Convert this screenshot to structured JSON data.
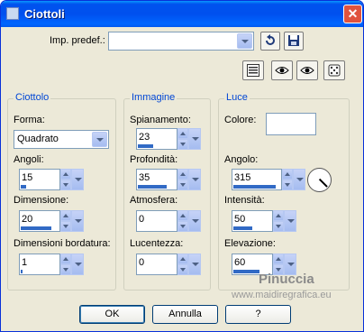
{
  "window": {
    "title": "Ciottoli",
    "close_glyph": "✕"
  },
  "toolbar": {
    "preset_label": "Imp. predef.:",
    "preset_value": "",
    "icons": {
      "reset": "reset-arrow-icon",
      "save": "save-disk-icon",
      "list": "list-view-icon",
      "eye_toggle_1": "eye-toggle-icon",
      "eye_toggle_2": "eye-icon",
      "randomize": "dice-icon"
    }
  },
  "ciottolo": {
    "title": "Ciottolo",
    "forma_label": "Forma:",
    "forma_value": "Quadrato",
    "angoli_label": "Angoli:",
    "angoli_value": "15",
    "dimensione_label": "Dimensione:",
    "dimensione_value": "20",
    "bordatura_label": "Dimensioni bordatura:",
    "bordatura_value": "1"
  },
  "immagine": {
    "title": "Immagine",
    "spianamento_label": "Spianamento:",
    "spianamento_value": "23",
    "profondita_label": "Profondità:",
    "profondita_value": "35",
    "atmosfera_label": "Atmosfera:",
    "atmosfera_value": "0",
    "lucentezza_label": "Lucentezza:",
    "lucentezza_value": "0"
  },
  "luce": {
    "title": "Luce",
    "colore_label": "Colore:",
    "colore_value": "#FFFFFF",
    "angolo_label": "Angolo:",
    "angolo_value": "315",
    "intensita_label": "Intensità:",
    "intensita_value": "50",
    "elevazione_label": "Elevazione:",
    "elevazione_value": "60"
  },
  "slider_fractions": {
    "angoli": 0.15,
    "dimensione": 0.8,
    "bordatura": 0.05,
    "spianamento": 0.4,
    "profondita": 0.75,
    "atmosfera": 0.0,
    "lucentezza": 0.0,
    "angolo": 0.9,
    "intensita": 0.5,
    "elevazione": 0.7
  },
  "buttons": {
    "ok": "OK",
    "annulla": "Annulla",
    "help": "?"
  },
  "watermark": {
    "text": "Pinuccia",
    "url": "www.maidiregrafica.eu"
  }
}
